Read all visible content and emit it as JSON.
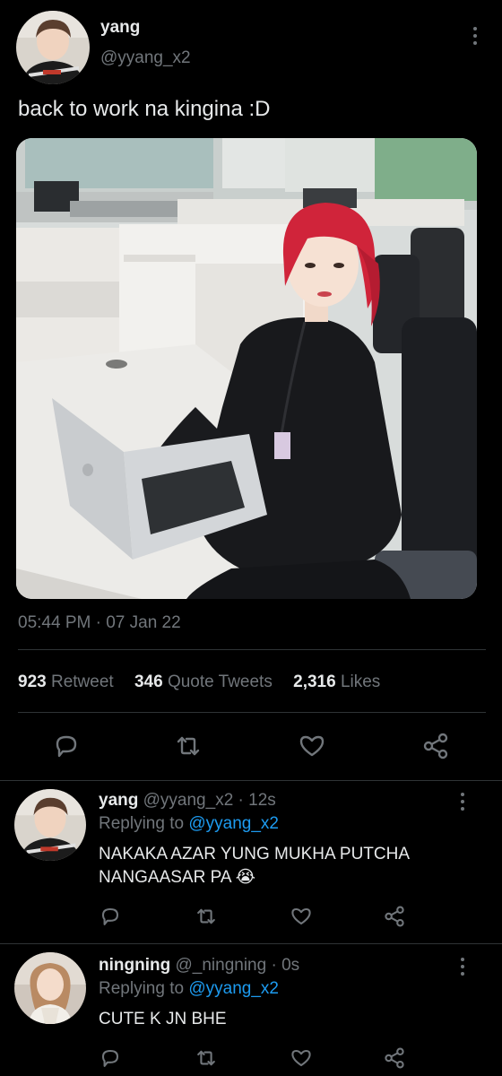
{
  "main_tweet": {
    "name": "yang",
    "handle": "@yyang_x2",
    "text": "back to work na kingina :D",
    "timestamp": "05:44 PM · 07 Jan 22",
    "stats": {
      "retweets_count": "923",
      "retweets_label": "Retweet",
      "quotes_count": "346",
      "quotes_label": "Quote Tweets",
      "likes_count": "2,316",
      "likes_label": "Likes"
    }
  },
  "replies": [
    {
      "name": "yang",
      "handle": "@yyang_x2 · 12s",
      "replying_prefix": "Replying to ",
      "replying_to": "@yyang_x2",
      "text_line1": "NAKAKA AZAR YUNG MUKHA PUTCHA",
      "text_line2": "NANGAASAR PA 😭"
    },
    {
      "name": "ningning",
      "handle": "@_ningning · 0s",
      "replying_prefix": "Replying to ",
      "replying_to": "@yyang_x2",
      "text_line1": "CUTE K JN BHE"
    }
  ],
  "icons": {
    "reply": "reply-icon",
    "retweet": "retweet-icon",
    "like": "like-icon",
    "share": "share-icon",
    "more": "more-vertical-icon"
  },
  "colors": {
    "background": "#000000",
    "text": "#e7e9ea",
    "secondary": "#71767b",
    "link": "#1d9bf0",
    "divider": "#2f3336"
  }
}
